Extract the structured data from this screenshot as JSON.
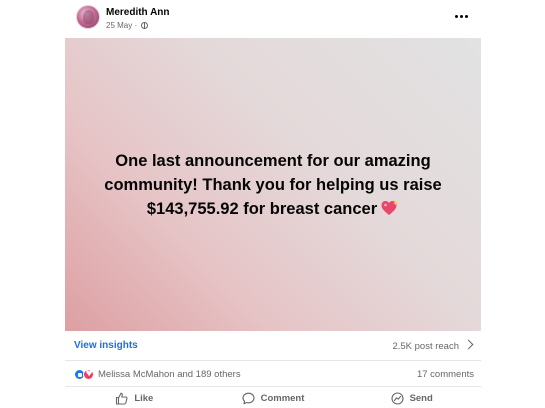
{
  "post": {
    "author": "Meredith Ann",
    "date": "25 May ·",
    "media_text": "One last announcement for our amazing community! Thank you for helping us raise $143,755.92 for breast cancer",
    "media_emoji": "sparkling-heart-icon"
  },
  "insights": {
    "link_label": "View insights",
    "reach_text": "2.5K post reach"
  },
  "reactions": {
    "icons": [
      "like-icon",
      "love-icon"
    ],
    "summary": "Melissa McMahon and 189 others",
    "comments": "17 comments"
  },
  "actions": {
    "like": "Like",
    "comment": "Comment",
    "send": "Send"
  },
  "colors": {
    "link": "#216fdb",
    "secondary_text": "#65676b",
    "like_blue": "#1877f2",
    "love_red": "#f33e58"
  }
}
